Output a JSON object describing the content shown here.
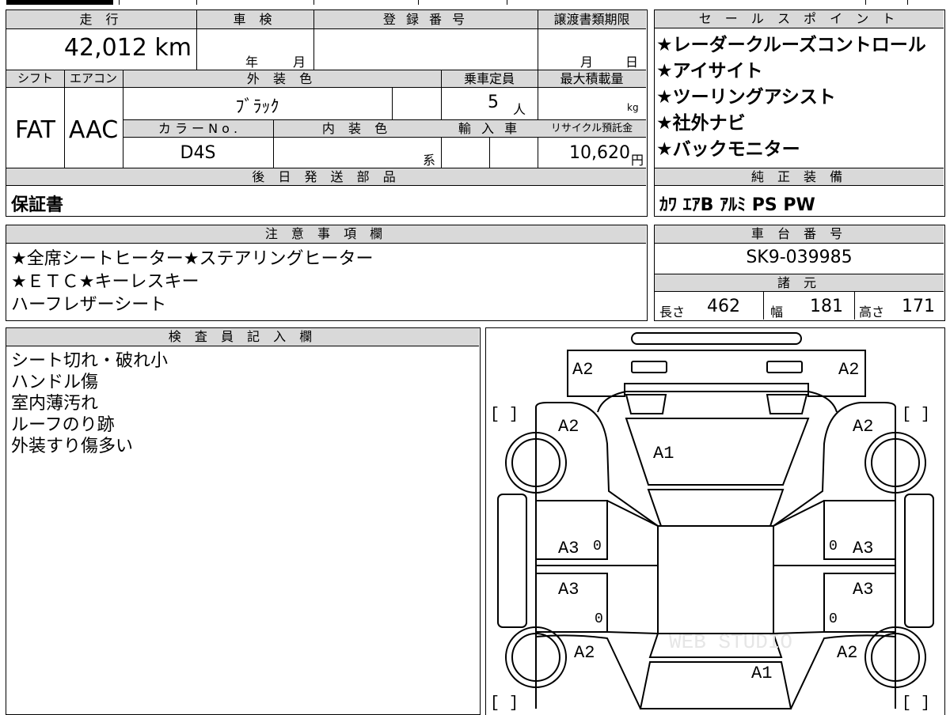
{
  "top_strip": {
    "filled": ""
  },
  "vehicle": {
    "mileage_label": "走 行",
    "mileage": "42,012 km",
    "shaken_label": "車 検",
    "shaken_year_unit": "年",
    "shaken_month_unit": "月",
    "registration_label": "登 録 番 号",
    "transfer_deadline_label": "譲渡書類期限",
    "transfer_month_unit": "月",
    "transfer_day_unit": "日",
    "shift_label": "シフト",
    "shift": "FAT",
    "aircon_label": "エアコン",
    "aircon": "AAC",
    "exterior_color_label": "外 装 色",
    "exterior_color": "ﾌﾞﾗｯｸ",
    "capacity_label": "乗車定員",
    "capacity": "5",
    "capacity_unit": "人",
    "max_load_label": "最大積載量",
    "max_load_unit": "kg",
    "color_no_label": "カ ラ ー N o .",
    "color_no": "D4S",
    "interior_color_label": "内 装 色",
    "interior_suffix": "系",
    "import_label": "輸 入 車",
    "recycle_label": "リサイクル預託金",
    "recycle_fee": "10,620",
    "recycle_unit": "円"
  },
  "later_parts": {
    "label": "後 日 発 送 部 品",
    "value": "保証書"
  },
  "sales_points": {
    "label": "セ ー ル ス ポ イ ン ト",
    "items": [
      "★レーダークルーズコントロール",
      "★アイサイト",
      "★ツーリングアシスト",
      "★社外ナビ",
      "★バックモニター"
    ]
  },
  "genuine_equipment": {
    "label": "純 正 装 備",
    "value": "ｶﾜ ｴｱB ｱﾙﾐ PS PW"
  },
  "caution": {
    "label": "注 意 事 項 欄",
    "lines": [
      "★全席シートヒーター★ステアリングヒーター",
      "★ＥＴＣ★キーレスキー",
      "ハーフレザーシート"
    ]
  },
  "chassis": {
    "label": "車 台 番 号",
    "value": "SK9-039985"
  },
  "specs": {
    "label": "諸 元",
    "length_label": "長さ",
    "length": "462",
    "width_label": "幅",
    "width": "181",
    "height_label": "高さ",
    "height": "171"
  },
  "inspector": {
    "label": "検 査 員 記 入 欄",
    "lines": [
      "シート切れ・破れ小",
      "ハンドル傷",
      "室内薄汚れ",
      "ルーフのり跡",
      "外装すり傷多い"
    ]
  },
  "diagram": {
    "marks": [
      "A2",
      "A2",
      "A2",
      "A2",
      "A1",
      "A3",
      "A3",
      "A3",
      "A3",
      "A2",
      "A2",
      "A1"
    ],
    "zeros": [
      "0",
      "0",
      "0",
      "0"
    ],
    "bracket_left": "[   ]",
    "bracket_right": "[   ]",
    "watermark": "WEB STUDIO"
  }
}
